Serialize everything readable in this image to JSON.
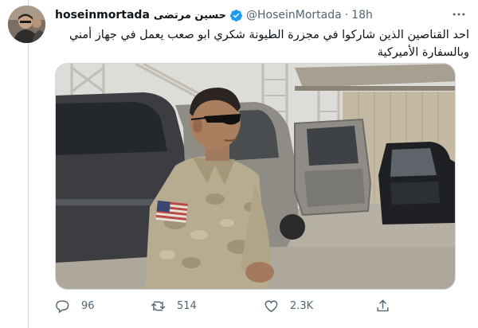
{
  "tweet": {
    "username": "hoseinmortada",
    "display_name": "حسين مرتضى",
    "handle": "@HoseinMortada",
    "separator": "·",
    "time": "18h",
    "text": "احد القناصين الذين شاركوا  في مجزرة الطيونة شكري ابو صعب يعمل في جهاز أمني وبالسفارة الأميركية",
    "replies": "96",
    "retweets": "514",
    "likes": "2.3K"
  },
  "colors": {
    "verified_blue": "#1d9bf0",
    "secondary_text": "#536471",
    "primary_text": "#0f1419"
  },
  "icons": [
    "more-icon",
    "verified-icon",
    "reply-icon",
    "retweet-icon",
    "like-icon",
    "share-icon"
  ]
}
